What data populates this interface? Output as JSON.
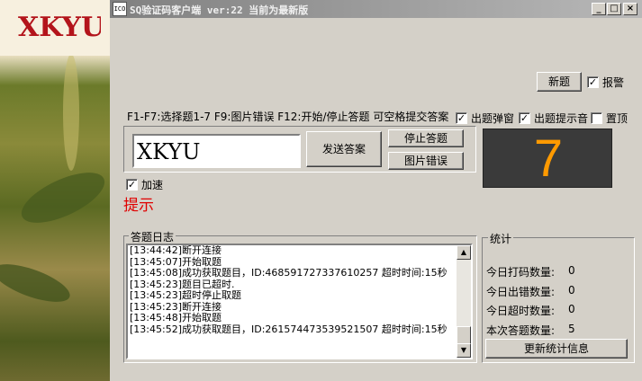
{
  "logo_text": "XKYU",
  "window": {
    "icon_text": "ICO",
    "title": "SQ验证码客户端 ver:22 当前为最新版",
    "minimize": "_",
    "maximize": "□",
    "close": "×"
  },
  "top": {
    "new_button": "新题",
    "alarm_label": "报警",
    "alarm_checked": "✓"
  },
  "hint_line": "F1-F7:选择题1-7 F9:图片错误 F12:开始/停止答题 可空格提交答案",
  "options": {
    "popup_label": "出题弹窗",
    "popup_checked": "✓",
    "sound_label": "出题提示音",
    "sound_checked": "✓",
    "topmost_label": "置顶",
    "topmost_checked": ""
  },
  "answer": {
    "value": "XKYU",
    "send_button": "发送答案",
    "stop_button": "停止答题",
    "image_error_button": "图片错误"
  },
  "speedup": {
    "label": "加速",
    "checked": "✓"
  },
  "display_digit": "7",
  "tip_text": "提示",
  "log": {
    "title": "答题日志",
    "lines": [
      "[13:44:42]断开连接",
      "[13:45:07]开始取题",
      "[13:45:08]成功获取题目，ID:468591727337610257 超时时间:15秒",
      "[13:45:23]题目已超时.",
      "[13:45:23]超时停止取题",
      "[13:45:23]断开连接",
      "[13:45:48]开始取题",
      "[13:45:52]成功获取题目，ID:261574473539521507 超时时间:15秒"
    ]
  },
  "stats": {
    "title": "统计",
    "rows": [
      {
        "label": "今日打码数量:",
        "value": "0"
      },
      {
        "label": "今日出错数量:",
        "value": "0"
      },
      {
        "label": "今日超时数量:",
        "value": "0"
      },
      {
        "label": "本次答题数量:",
        "value": "5"
      }
    ],
    "refresh_button": "更新统计信息"
  },
  "colors": {
    "digit": "#ff9a00",
    "tip": "#e00000",
    "display_bg": "#3a3a3a"
  }
}
